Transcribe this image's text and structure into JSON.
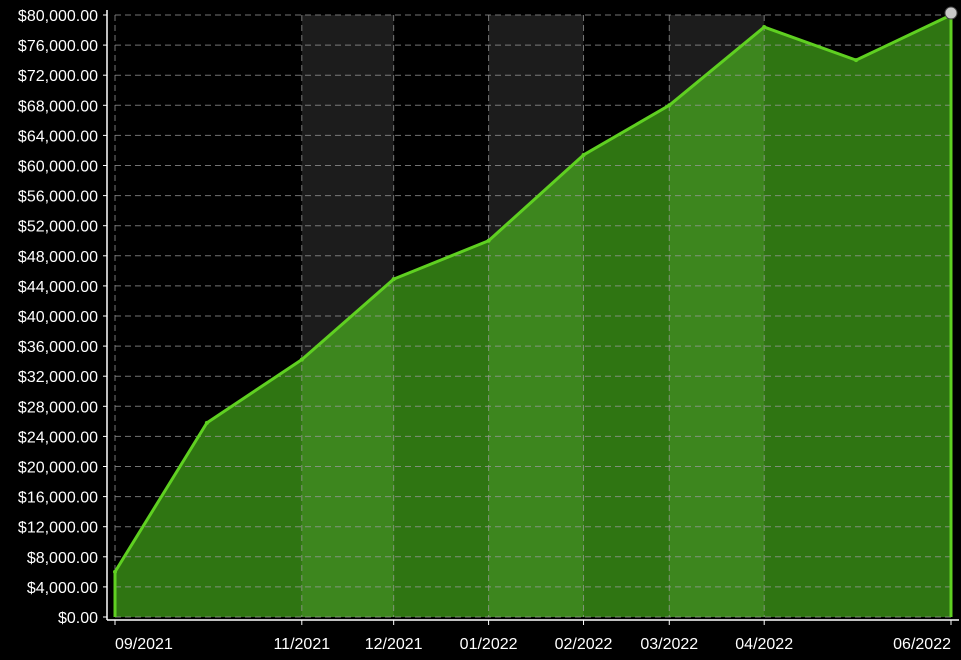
{
  "chart_data": {
    "type": "area",
    "title": "",
    "xlabel": "",
    "ylabel": "",
    "ylim": [
      0,
      80000
    ],
    "y_ticks": [
      0,
      4000,
      8000,
      12000,
      16000,
      20000,
      24000,
      28000,
      32000,
      36000,
      40000,
      44000,
      48000,
      52000,
      56000,
      60000,
      64000,
      68000,
      72000,
      76000,
      80000
    ],
    "y_tick_labels": [
      "$0.00",
      "$4,000.00",
      "$8,000.00",
      "$12,000.00",
      "$16,000.00",
      "$20,000.00",
      "$24,000.00",
      "$28,000.00",
      "$32,000.00",
      "$36,000.00",
      "$40,000.00",
      "$44,000.00",
      "$48,000.00",
      "$52,000.00",
      "$56,000.00",
      "$60,000.00",
      "$64,000.00",
      "$68,000.00",
      "$72,000.00",
      "$76,000.00",
      "$80,000.00"
    ],
    "x_ticks": [
      {
        "date": "2021-09-01",
        "label": "09/2021"
      },
      {
        "date": "2021-11-01",
        "label": "11/2021"
      },
      {
        "date": "2021-12-01",
        "label": "12/2021"
      },
      {
        "date": "2022-01-01",
        "label": "01/2022"
      },
      {
        "date": "2022-02-01",
        "label": "02/2022"
      },
      {
        "date": "2022-03-01",
        "label": "03/2022"
      },
      {
        "date": "2022-04-01",
        "label": "04/2022"
      },
      {
        "date": "2022-06-01",
        "label": "06/2022"
      }
    ],
    "xlim": [
      "2021-09-01",
      "2022-06-01"
    ],
    "series": [
      {
        "points": [
          {
            "x": "2021-09-01",
            "y": 6000
          },
          {
            "x": "2021-10-01",
            "y": 25800
          },
          {
            "x": "2021-11-01",
            "y": 34200
          },
          {
            "x": "2021-12-01",
            "y": 44900
          },
          {
            "x": "2022-01-01",
            "y": 50000
          },
          {
            "x": "2022-02-01",
            "y": 61400
          },
          {
            "x": "2022-03-01",
            "y": 68000
          },
          {
            "x": "2022-04-01",
            "y": 78400
          },
          {
            "x": "2022-05-01",
            "y": 74000
          },
          {
            "x": "2022-06-01",
            "y": 80000
          }
        ]
      }
    ],
    "grid": true,
    "colors": {
      "background": "#000000",
      "band": "#1c1c1c",
      "grid": "#9a9a9a",
      "line": "#5fd021",
      "fill": "#2f7512",
      "fill_highlight": "#3d861e",
      "text": "#ffffff",
      "end_marker": "#c8c8c8"
    }
  }
}
